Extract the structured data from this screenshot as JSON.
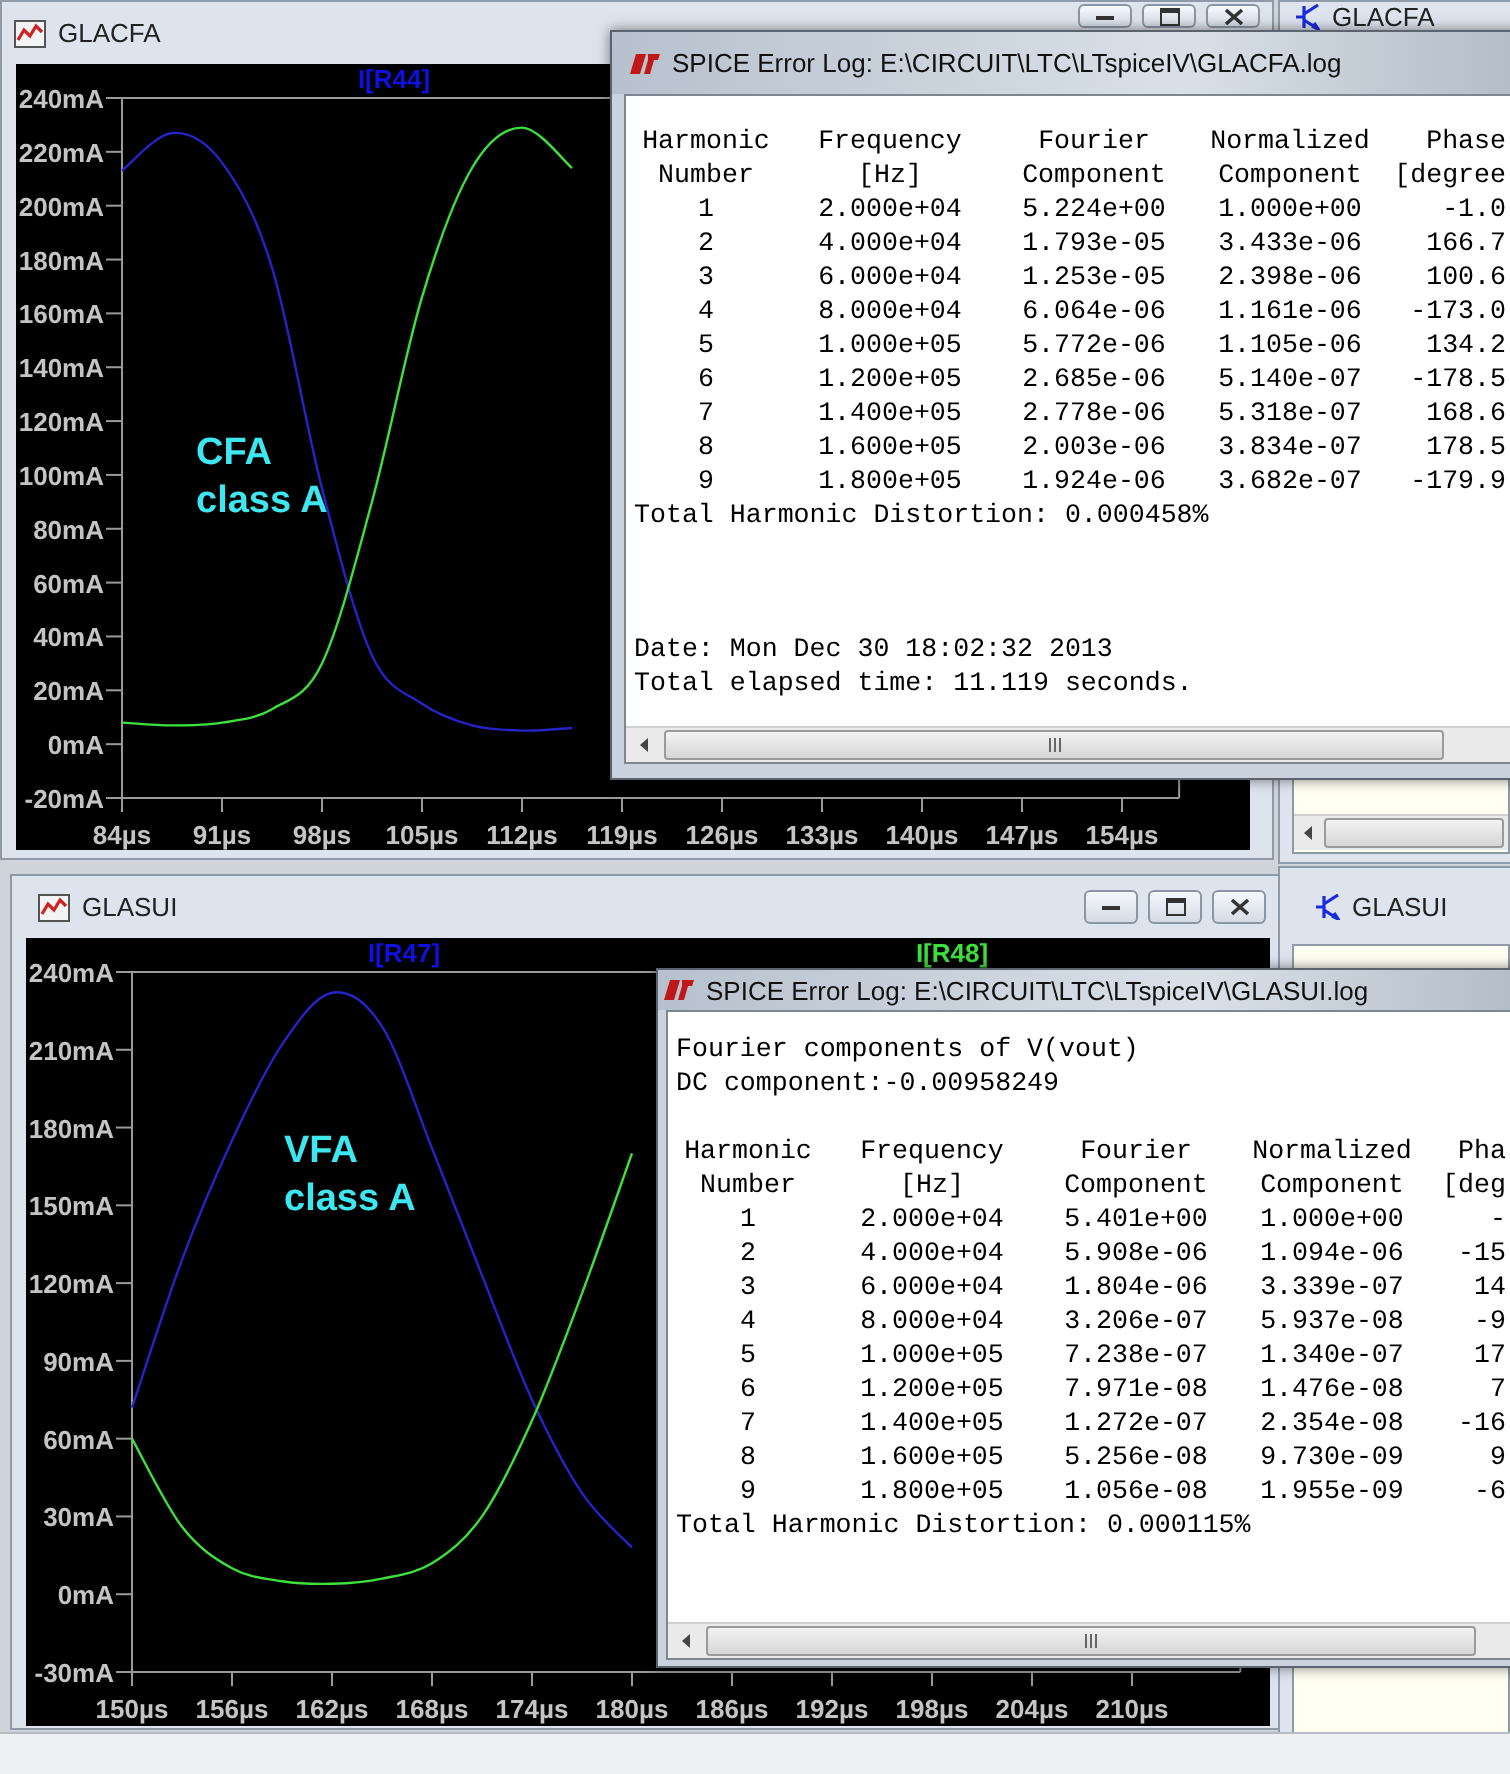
{
  "plot_windows": [
    {
      "title": "GLACFA",
      "chart_data": {
        "type": "line",
        "x": [
          84,
          87.5,
          91,
          94.5,
          98,
          101.5,
          105,
          108.5,
          112,
          115.5
        ],
        "series": [
          {
            "name": "I[R44]",
            "color": "#2424c8",
            "values": [
              213,
              227,
              216,
              177,
              95,
              33,
              15,
              7,
              5,
              6
            ]
          },
          {
            "color": "#3ee03e",
            "values": [
              8,
              7,
              8,
              13,
              30,
              90,
              166,
              214,
              229,
              214
            ]
          }
        ],
        "xlim": [
          84,
          158
        ],
        "ylim": [
          -20,
          240
        ],
        "xticks": [
          {
            "value": 84,
            "label": "84µs"
          },
          {
            "value": 91,
            "label": "91µs"
          },
          {
            "value": 98,
            "label": "98µs"
          },
          {
            "value": 105,
            "label": "105µs"
          },
          {
            "value": 112,
            "label": "112µs"
          },
          {
            "value": 119,
            "label": "119µs"
          },
          {
            "value": 126,
            "label": "126µs"
          },
          {
            "value": 133,
            "label": "133µs"
          },
          {
            "value": 140,
            "label": "140µs"
          },
          {
            "value": 147,
            "label": "147µs"
          },
          {
            "value": 154,
            "label": "154µs"
          }
        ],
        "yticks": [
          {
            "value": 240,
            "label": "240mA"
          },
          {
            "value": 220,
            "label": "220mA"
          },
          {
            "value": 200,
            "label": "200mA"
          },
          {
            "value": 180,
            "label": "180mA"
          },
          {
            "value": 160,
            "label": "160mA"
          },
          {
            "value": 140,
            "label": "140mA"
          },
          {
            "value": 120,
            "label": "120mA"
          },
          {
            "value": 100,
            "label": "100mA"
          },
          {
            "value": 80,
            "label": "80mA"
          },
          {
            "value": 60,
            "label": "60mA"
          },
          {
            "value": 40,
            "label": "40mA"
          },
          {
            "value": 20,
            "label": "20mA"
          },
          {
            "value": 0,
            "label": "0mA"
          },
          {
            "value": -20,
            "label": "-20mA"
          }
        ],
        "annotations": [
          "CFA",
          "class A"
        ]
      }
    },
    {
      "title": "GLASUI",
      "chart_data": {
        "type": "line",
        "x": [
          150,
          153,
          156,
          159,
          162,
          165,
          168,
          171,
          174,
          177,
          180
        ],
        "series": [
          {
            "name": "I[R47]",
            "color": "#2424c8",
            "values": [
              72,
              129,
              175,
              212,
              232,
              219,
              172,
              123,
              75,
              39,
              18
            ]
          },
          {
            "name": "I[R48]",
            "color": "#3ee03e",
            "values": [
              60,
              26,
              10,
              5,
              4,
              6,
              12,
              30,
              67,
              116,
              170
            ]
          }
        ],
        "xlim": [
          150,
          216.5
        ],
        "ylim": [
          -30,
          240
        ],
        "xticks": [
          {
            "value": 150,
            "label": "150µs"
          },
          {
            "value": 156,
            "label": "156µs"
          },
          {
            "value": 162,
            "label": "162µs"
          },
          {
            "value": 168,
            "label": "168µs"
          },
          {
            "value": 174,
            "label": "174µs"
          },
          {
            "value": 180,
            "label": "180µs"
          },
          {
            "value": 186,
            "label": "186µs"
          },
          {
            "value": 192,
            "label": "192µs"
          },
          {
            "value": 198,
            "label": "198µs"
          },
          {
            "value": 204,
            "label": "204µs"
          },
          {
            "value": 210,
            "label": "210µs"
          }
        ],
        "yticks": [
          {
            "value": 240,
            "label": "240mA"
          },
          {
            "value": 210,
            "label": "210mA"
          },
          {
            "value": 180,
            "label": "180mA"
          },
          {
            "value": 150,
            "label": "150mA"
          },
          {
            "value": 120,
            "label": "120mA"
          },
          {
            "value": 90,
            "label": "90mA"
          },
          {
            "value": 60,
            "label": "60mA"
          },
          {
            "value": 30,
            "label": "30mA"
          },
          {
            "value": 0,
            "label": "0mA"
          },
          {
            "value": -30,
            "label": "-30mA"
          }
        ],
        "annotations": [
          "VFA",
          "class A"
        ]
      }
    }
  ],
  "schematic_windows": [
    {
      "title": "GLACFA"
    },
    {
      "title": "GLASUI"
    }
  ],
  "log_windows": [
    {
      "title": "SPICE Error Log: E:\\CIRCUIT\\LTC\\LTspiceIV\\GLACFA.log",
      "table": {
        "header": [
          [
            "Harmonic",
            "Frequency",
            "Fourier",
            "Normalized",
            "Phase"
          ],
          [
            "Number",
            "[Hz]",
            "Component",
            "Component",
            "[degree"
          ]
        ],
        "rows": [
          [
            "1",
            "2.000e+04",
            "5.224e+00",
            "1.000e+00",
            "-1.0"
          ],
          [
            "2",
            "4.000e+04",
            "1.793e-05",
            "3.433e-06",
            "166.7"
          ],
          [
            "3",
            "6.000e+04",
            "1.253e-05",
            "2.398e-06",
            "100.6"
          ],
          [
            "4",
            "8.000e+04",
            "6.064e-06",
            "1.161e-06",
            "-173.0"
          ],
          [
            "5",
            "1.000e+05",
            "5.772e-06",
            "1.105e-06",
            "134.2"
          ],
          [
            "6",
            "1.200e+05",
            "2.685e-06",
            "5.140e-07",
            "-178.5"
          ],
          [
            "7",
            "1.400e+05",
            "2.778e-06",
            "5.318e-07",
            "168.6"
          ],
          [
            "8",
            "1.600e+05",
            "2.003e-06",
            "3.834e-07",
            "178.5"
          ],
          [
            "9",
            "1.800e+05",
            "1.924e-06",
            "3.682e-07",
            "-179.9"
          ]
        ]
      },
      "summary": "Total Harmonic Distortion: 0.000458%",
      "footer_lines": [
        "Date: Mon Dec 30 18:02:32 2013",
        "Total elapsed time: 11.119 seconds."
      ]
    },
    {
      "title": "SPICE Error Log: E:\\CIRCUIT\\LTC\\LTspiceIV\\GLASUI.log",
      "header_lines": [
        "Fourier components of V(vout)",
        "DC component:-0.00958249"
      ],
      "table": {
        "header": [
          [
            "Harmonic",
            "Frequency",
            "Fourier",
            "Normalized",
            "Pha"
          ],
          [
            "Number",
            "[Hz]",
            "Component",
            "Component",
            "[deg"
          ]
        ],
        "rows": [
          [
            "1",
            "2.000e+04",
            "5.401e+00",
            "1.000e+00",
            "-"
          ],
          [
            "2",
            "4.000e+04",
            "5.908e-06",
            "1.094e-06",
            "-15"
          ],
          [
            "3",
            "6.000e+04",
            "1.804e-06",
            "3.339e-07",
            "14"
          ],
          [
            "4",
            "8.000e+04",
            "3.206e-07",
            "5.937e-08",
            "-9"
          ],
          [
            "5",
            "1.000e+05",
            "7.238e-07",
            "1.340e-07",
            "17"
          ],
          [
            "6",
            "1.200e+05",
            "7.971e-08",
            "1.476e-08",
            "7"
          ],
          [
            "7",
            "1.400e+05",
            "1.272e-07",
            "2.354e-08",
            "-16"
          ],
          [
            "8",
            "1.600e+05",
            "5.256e-08",
            "9.730e-09",
            "9"
          ],
          [
            "9",
            "1.800e+05",
            "1.056e-08",
            "1.955e-09",
            "-6"
          ]
        ]
      },
      "summary": "Total Harmonic Distortion: 0.000115%"
    }
  ]
}
